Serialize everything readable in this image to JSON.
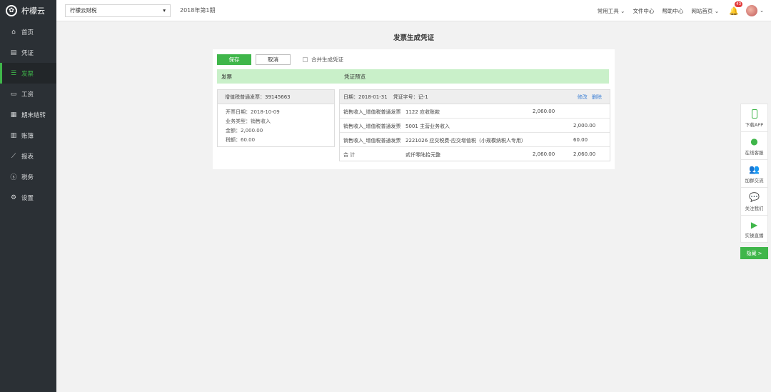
{
  "app": {
    "name": "柠檬云"
  },
  "sidebar": {
    "items": [
      {
        "label": "首页",
        "icon": "home-icon"
      },
      {
        "label": "凭证",
        "icon": "voucher-icon"
      },
      {
        "label": "发票",
        "icon": "invoice-icon"
      },
      {
        "label": "工资",
        "icon": "salary-icon"
      },
      {
        "label": "期末结转",
        "icon": "calendar-icon"
      },
      {
        "label": "账簿",
        "icon": "ledger-icon"
      },
      {
        "label": "报表",
        "icon": "chart-icon"
      },
      {
        "label": "税务",
        "icon": "tax-icon"
      },
      {
        "label": "设置",
        "icon": "gear-icon"
      }
    ],
    "active_index": 2
  },
  "header": {
    "company": "柠檬云财税",
    "period": "2018年第1期",
    "links": [
      "常用工具",
      "文件中心",
      "帮助中心",
      "网站首页"
    ],
    "notification_count": "43"
  },
  "page": {
    "title": "发票生成凭证"
  },
  "toolbar": {
    "save_label": "保存",
    "cancel_label": "取消",
    "merge_label": "合并生成凭证"
  },
  "columns": {
    "invoice": "发票",
    "preview": "凭证预览"
  },
  "invoice": {
    "header": "增值税普通发票：39145663",
    "lines": [
      "开票日期：2018-10-09",
      "业务类型：销售收入",
      "金额：2,000.00",
      "税额：60.00"
    ]
  },
  "voucher": {
    "date": "日期：2018-01-31",
    "number": "凭证字号：记-1",
    "edit_label": "修改",
    "delete_label": "删除",
    "rows": [
      {
        "summary": "销售收入_增值税普通发票",
        "account": "1122 应收账款",
        "debit": "2,060.00",
        "credit": ""
      },
      {
        "summary": "销售收入_增值税普通发票",
        "account": "5001 主营业务收入",
        "debit": "",
        "credit": "2,000.00"
      },
      {
        "summary": "销售收入_增值税普通发票",
        "account": "2221026 应交税费-应交增值税（小规模纳税人专用）",
        "debit": "",
        "credit": "60.00"
      },
      {
        "summary": "合 计",
        "account": "贰仟零陆拾元整",
        "debit": "2,060.00",
        "credit": "2,060.00"
      }
    ]
  },
  "float_bar": {
    "items": [
      "下载APP",
      "在线客服",
      "加群交流",
      "关注我们",
      "实操直播"
    ],
    "hide_label": "隐藏 >"
  },
  "colors": {
    "accent": "#3fb64a",
    "sidebar_bg": "#2b3035",
    "link": "#3a7fd5",
    "header_strip": "#c9f0c9"
  }
}
